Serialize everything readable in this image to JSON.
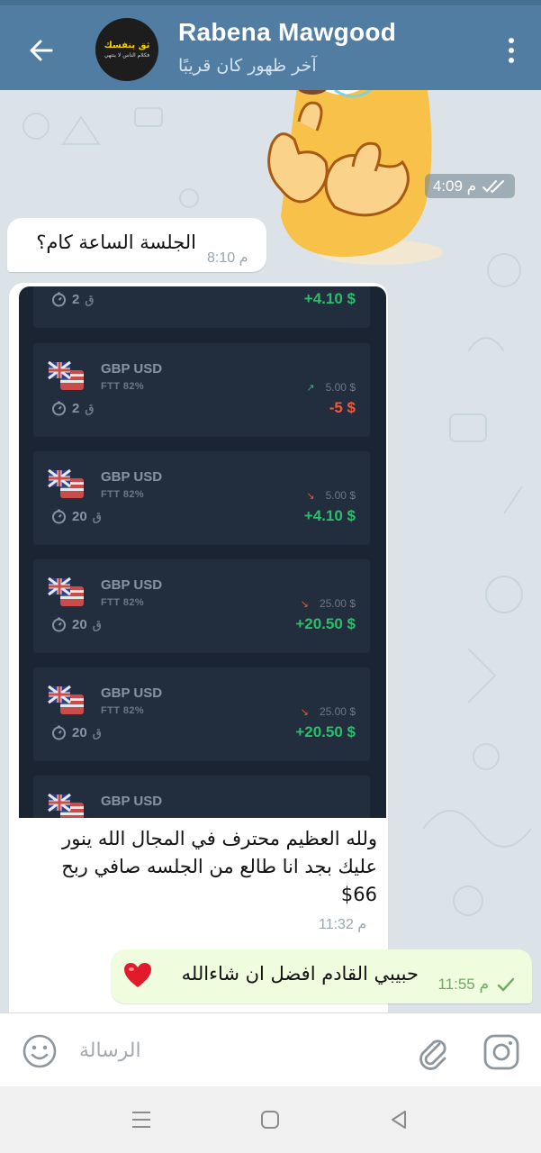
{
  "header": {
    "title": "Rabena Mawgood",
    "subtitle": "آخر ظهور كان قريبًا",
    "avatar_text_1": "ثق بنفسك",
    "avatar_text_2": "فكلام الناس لا ينتهي",
    "back_icon": "arrow-left-icon",
    "menu_icon": "more-vertical-icon"
  },
  "messages": {
    "sticker_time": "4:09 م",
    "question": {
      "text": "الجلسة الساعة كام؟",
      "time": "8:10 م"
    },
    "screenshot": {
      "cards": [
        {
          "pair": "",
          "ftt": "",
          "stake": "",
          "direction": "",
          "result": "+4.10 $",
          "result_sign": "pos",
          "duration": "2",
          "qaf": "ق"
        },
        {
          "pair": "GBP USD",
          "ftt": "FTT  82%",
          "stake": "5.00 $",
          "direction": "up",
          "result": "-5 $",
          "result_sign": "neg",
          "duration": "2",
          "qaf": "ق"
        },
        {
          "pair": "GBP USD",
          "ftt": "FTT  82%",
          "stake": "5.00 $",
          "direction": "down",
          "result": "+4.10 $",
          "result_sign": "pos",
          "duration": "20",
          "qaf": "ق"
        },
        {
          "pair": "GBP USD",
          "ftt": "FTT  82%",
          "stake": "25.00 $",
          "direction": "down",
          "result": "+20.50 $",
          "result_sign": "pos",
          "duration": "20",
          "qaf": "ق"
        },
        {
          "pair": "GBP USD",
          "ftt": "FTT  82%",
          "stake": "25.00 $",
          "direction": "down",
          "result": "+20.50 $",
          "result_sign": "pos",
          "duration": "20",
          "qaf": "ق"
        },
        {
          "pair": "GBP USD",
          "ftt": "",
          "stake": "",
          "direction": "",
          "result": "",
          "result_sign": "pos",
          "duration": "",
          "qaf": ""
        }
      ],
      "caption": "ولله العظيم محترف في المجال الله ينور عليك بجد انا طالع من الجلسه صافي ربح 66$",
      "time": "11:32 م"
    },
    "reply": {
      "text": "حبيبي القادم افضل ان شاءالله",
      "time": "11:55 م",
      "heart_icon": "red-heart-icon",
      "check_icon": "single-check-icon"
    }
  },
  "input": {
    "placeholder": "الرسالة",
    "emoji_icon": "emoji-smile-icon",
    "attach_icon": "paperclip-icon",
    "camera_icon": "camera-icon"
  },
  "navbar": {
    "recents_icon": "recents-lines-icon",
    "home_icon": "home-square-icon",
    "back_icon": "back-triangle-icon"
  },
  "colors": {
    "header": "#517da2",
    "chat_bg": "#dbe3e8",
    "outgoing_bubble": "#effdde",
    "profit_green": "#2ebd6b",
    "loss_red": "#f05a3a"
  }
}
